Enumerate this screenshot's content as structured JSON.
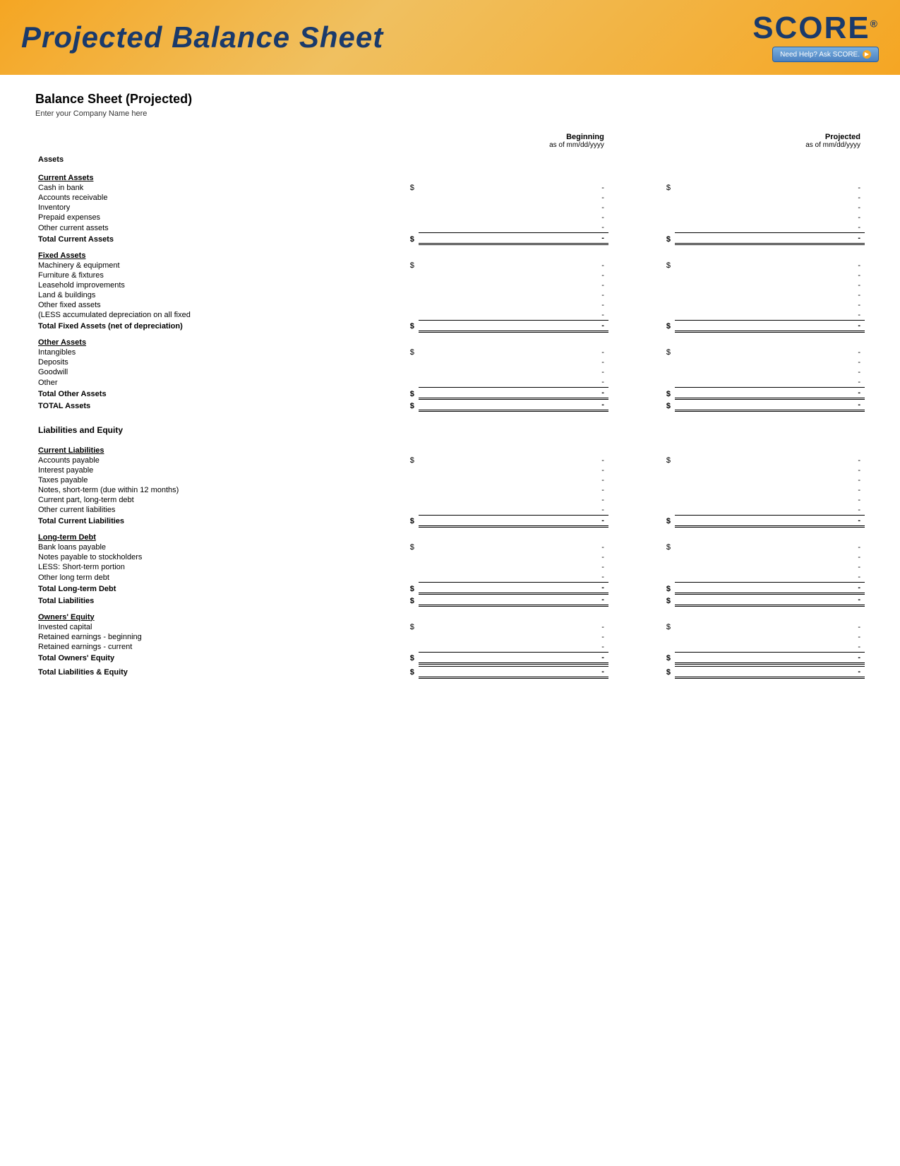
{
  "header": {
    "title": "Projected Balance Sheet",
    "score_text": "SCORE",
    "score_reg": "®",
    "need_help": "Need Help? Ask SCORE."
  },
  "document": {
    "title": "Balance Sheet (Projected)",
    "company_placeholder": "Enter your Company Name here",
    "col_beginning_label": "Beginning",
    "col_beginning_date": "as of mm/dd/yyyy",
    "col_projected_label": "Projected",
    "col_projected_date": "as of mm/dd/yyyy"
  },
  "sections": {
    "assets_label": "Assets",
    "current_assets": {
      "header": "Current Assets",
      "rows": [
        {
          "label": "Cash in bank",
          "show_dollar": true,
          "begin": "-",
          "proj": "-"
        },
        {
          "label": "Accounts receivable",
          "show_dollar": false,
          "begin": "-",
          "proj": "-"
        },
        {
          "label": "Inventory",
          "show_dollar": false,
          "begin": "-",
          "proj": "-"
        },
        {
          "label": "Prepaid expenses",
          "show_dollar": false,
          "begin": "-",
          "proj": "-"
        },
        {
          "label": "Other current assets",
          "show_dollar": false,
          "begin": "-",
          "proj": "-"
        }
      ],
      "total_label": "Total Current Assets",
      "total_begin": "-",
      "total_proj": "-"
    },
    "fixed_assets": {
      "header": "Fixed Assets",
      "rows": [
        {
          "label": "Machinery & equipment",
          "show_dollar": true,
          "begin": "-",
          "proj": "-"
        },
        {
          "label": "Furniture & fixtures",
          "show_dollar": false,
          "begin": "-",
          "proj": "-"
        },
        {
          "label": "Leasehold improvements",
          "show_dollar": false,
          "begin": "-",
          "proj": "-"
        },
        {
          "label": "Land & buildings",
          "show_dollar": false,
          "begin": "-",
          "proj": "-"
        },
        {
          "label": "Other fixed assets",
          "show_dollar": false,
          "begin": "-",
          "proj": "-"
        },
        {
          "label": "(LESS accumulated depreciation on all fixed",
          "show_dollar": false,
          "begin": "-",
          "proj": "-"
        }
      ],
      "total_label": "Total Fixed Assets (net of depreciation)",
      "total_begin": "-",
      "total_proj": "-"
    },
    "other_assets": {
      "header": "Other Assets",
      "rows": [
        {
          "label": "Intangibles",
          "show_dollar": true,
          "begin": "-",
          "proj": "-"
        },
        {
          "label": "Deposits",
          "show_dollar": false,
          "begin": "-",
          "proj": "-"
        },
        {
          "label": "Goodwill",
          "show_dollar": false,
          "begin": "-",
          "proj": "-"
        },
        {
          "label": "Other",
          "show_dollar": false,
          "begin": "-",
          "proj": "-"
        }
      ],
      "total_label": "Total Other Assets",
      "total_begin": "-",
      "total_proj": "-"
    },
    "total_assets": {
      "label": "TOTAL Assets",
      "begin": "-",
      "proj": "-"
    },
    "liabilities_equity_header": "Liabilities and Equity",
    "current_liabilities": {
      "header": "Current Liabilities",
      "rows": [
        {
          "label": "Accounts payable",
          "show_dollar": true,
          "begin": "-",
          "proj": "-"
        },
        {
          "label": "Interest payable",
          "show_dollar": false,
          "begin": "-",
          "proj": "-"
        },
        {
          "label": "Taxes payable",
          "show_dollar": false,
          "begin": "-",
          "proj": "-"
        },
        {
          "label": "Notes, short-term (due within 12 months)",
          "show_dollar": false,
          "begin": "-",
          "proj": "-"
        },
        {
          "label": "Current part, long-term debt",
          "show_dollar": false,
          "begin": "-",
          "proj": "-"
        },
        {
          "label": "Other current liabilities",
          "show_dollar": false,
          "begin": "-",
          "proj": "-"
        }
      ],
      "total_label": "Total Current Liabilities",
      "total_begin": "-",
      "total_proj": "-"
    },
    "long_term_debt": {
      "header": "Long-term Debt",
      "rows": [
        {
          "label": "Bank loans payable",
          "show_dollar": true,
          "begin": "-",
          "proj": "-"
        },
        {
          "label": "Notes payable to stockholders",
          "show_dollar": false,
          "begin": "-",
          "proj": "-"
        },
        {
          "label": "LESS: Short-term portion",
          "show_dollar": false,
          "begin": "-",
          "proj": "-"
        },
        {
          "label": "Other long term debt",
          "show_dollar": false,
          "begin": "-",
          "proj": "-"
        }
      ],
      "total_label": "Total Long-term Debt",
      "total_begin": "-",
      "total_proj": "-"
    },
    "total_liabilities": {
      "label": "Total Liabilities",
      "begin": "-",
      "proj": "-"
    },
    "owners_equity": {
      "header": "Owners' Equity",
      "rows": [
        {
          "label": "Invested capital",
          "show_dollar": true,
          "begin": "-",
          "proj": "-"
        },
        {
          "label": "Retained earnings - beginning",
          "show_dollar": false,
          "begin": "-",
          "proj": "-"
        },
        {
          "label": "Retained earnings - current",
          "show_dollar": false,
          "begin": "-",
          "proj": "-"
        }
      ],
      "total_label": "Total Owners' Equity",
      "total_begin": "-",
      "total_proj": "-"
    },
    "total_liabilities_equity": {
      "label": "Total Liabilities & Equity",
      "begin": "-",
      "proj": "-"
    }
  }
}
